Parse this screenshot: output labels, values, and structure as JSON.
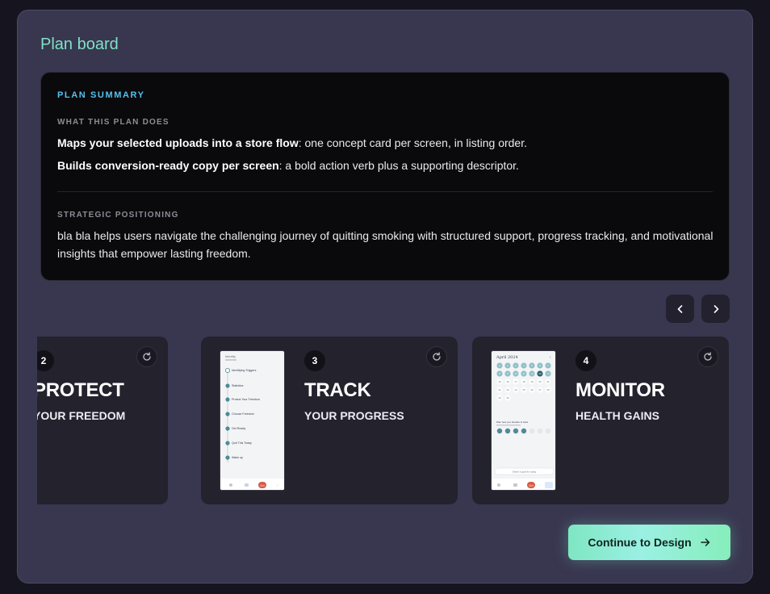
{
  "panel": {
    "title": "Plan board"
  },
  "summary": {
    "heading": "PLAN SUMMARY",
    "what_heading": "WHAT THIS PLAN DOES",
    "what_items": [
      {
        "bold": "Maps your selected uploads into a store flow",
        "rest": ": one concept card per screen, in listing order."
      },
      {
        "bold": "Builds conversion-ready copy per screen",
        "rest": ": a bold action verb plus a supporting descriptor."
      }
    ],
    "strategy_heading": "STRATEGIC POSITIONING",
    "strategy_text": "bla bla helps users navigate the challenging journey of quitting smoking with structured support, progress tracking, and motivational insights that empower lasting freedom."
  },
  "cards": [
    {
      "number": "2",
      "headline": "PROTECT",
      "subline": "YOUR FREEDOM"
    },
    {
      "number": "3",
      "headline": "TRACK",
      "subline": "YOUR PROGRESS"
    },
    {
      "number": "4",
      "headline": "MONITOR",
      "subline": "HEALTH GAINS"
    }
  ],
  "thumb3": {
    "header": "Identity",
    "steps": [
      "Identifying Triggers",
      "Statistics",
      "Protect Your Freedom",
      "Choose Freedom",
      "Get Ready",
      "Quit This Today",
      "Wake up"
    ],
    "nav_badge": "Quit"
  },
  "thumb4": {
    "header": "April 2024",
    "footer_label": "Share a goal for today",
    "days": [
      "1",
      "2",
      "3",
      "4",
      "5",
      "6",
      "7",
      "8",
      "9",
      "10",
      "11",
      "12",
      "13",
      "14",
      "15",
      "16",
      "17",
      "18",
      "19",
      "20",
      "21",
      "22",
      "23",
      "24",
      "25",
      "26",
      "27",
      "28",
      "29",
      "30"
    ],
    "nav_badge": "Quit"
  },
  "actions": {
    "continue_label": "Continue to Design"
  },
  "icons": {
    "prev": "chevron-left-icon",
    "next": "chevron-right-icon",
    "refresh": "refresh-icon",
    "arrow": "arrow-right-icon"
  },
  "colors": {
    "accent": "#7ee3c5",
    "summary_heading": "#55c1f0",
    "panel_bg": "#393650",
    "card_bg": "#23222d"
  }
}
